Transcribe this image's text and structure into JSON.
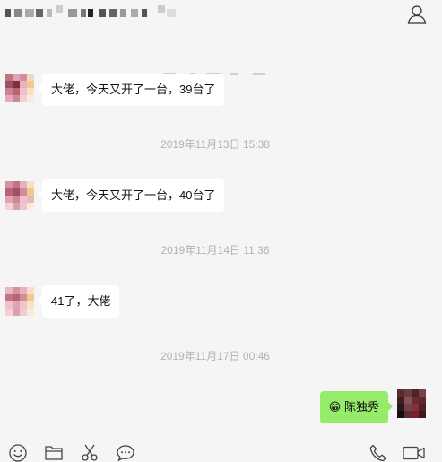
{
  "header": {
    "contact_icon": "contact-profile-icon"
  },
  "messages": [
    {
      "type": "incoming",
      "text": "大佬，今天又开了一台，39台了"
    },
    {
      "type": "timestamp",
      "text": "2019年11月13日 15:38"
    },
    {
      "type": "incoming",
      "text": "大佬，今天又开了一台，40台了"
    },
    {
      "type": "timestamp",
      "text": "2019年11月14日 11:36"
    },
    {
      "type": "incoming",
      "text": "41了，大佬"
    },
    {
      "type": "timestamp",
      "text": "2019年11月17日 00:46"
    },
    {
      "type": "outgoing",
      "emoji": "😁",
      "text": "陈独秀"
    }
  ],
  "toolbar": {
    "icons": [
      "emoji-icon",
      "folder-icon",
      "scissors-icon",
      "chat-bubble-icon",
      "phone-icon",
      "video-icon"
    ]
  },
  "colors": {
    "background": "#f5f5f5",
    "incoming_bubble": "#ffffff",
    "outgoing_bubble": "#95ec69",
    "timestamp": "#b2b2b2"
  }
}
